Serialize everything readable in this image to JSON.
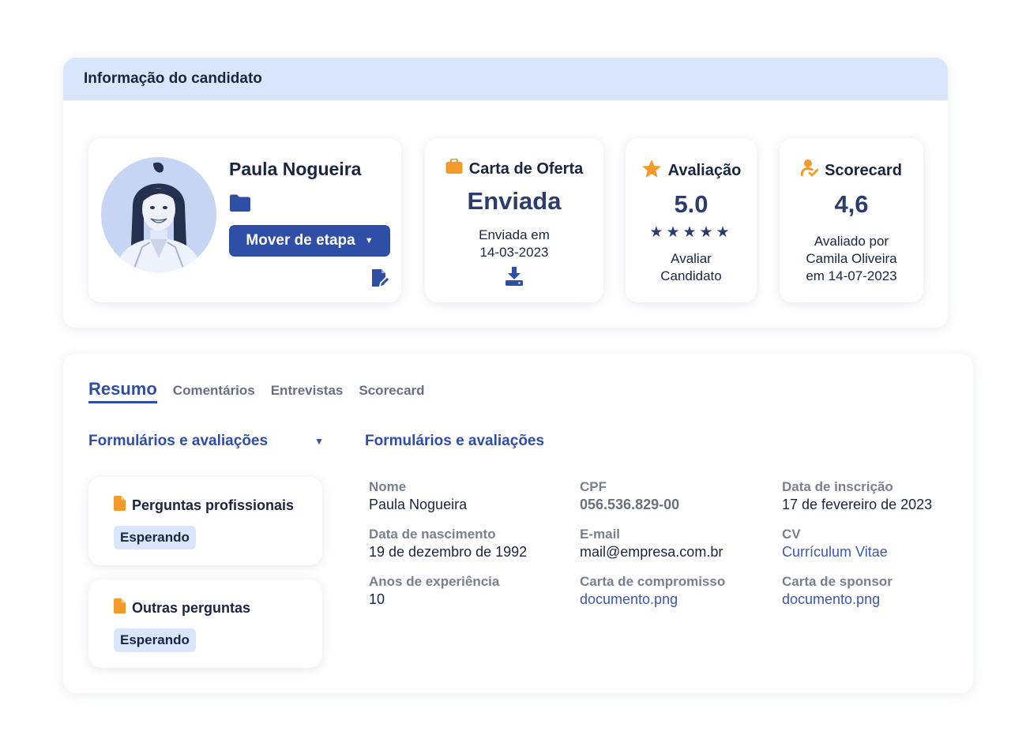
{
  "header": {
    "title": "Informação do candidato"
  },
  "candidate": {
    "name": "Paula Nogueira",
    "move_stage_label": "Mover de etapa"
  },
  "offer": {
    "title": "Carta de Oferta",
    "status": "Enviada",
    "sent_label": "Enviada em",
    "sent_date": "14-03-2023"
  },
  "rating": {
    "title": "Avaliação",
    "value": "5.0",
    "stars": "★★★★★",
    "stars_count": 5,
    "action_line1": "Avaliar",
    "action_line2": "Candidato"
  },
  "scorecard": {
    "title": "Scorecard",
    "value": "4,6",
    "line1": "Avaliado por",
    "line2": "Camila Oliveira",
    "line3": "em 14-07-2023"
  },
  "tabs": [
    {
      "label": "Resumo",
      "active": true
    },
    {
      "label": "Comentários"
    },
    {
      "label": "Entrevistas"
    },
    {
      "label": "Scorecard"
    }
  ],
  "forms": {
    "dropdown_label": "Formulários e avaliações",
    "items": [
      {
        "title": "Perguntas profissionais",
        "status": "Esperando"
      },
      {
        "title": "Outras perguntas",
        "status": "Esperando"
      }
    ]
  },
  "details": {
    "title": "Formulários e avaliações",
    "fields": [
      {
        "label": "Nome",
        "value": "Paula Nogueira"
      },
      {
        "label": "CPF",
        "value": "056.536.829-00"
      },
      {
        "label": "Data de inscrição",
        "value": "17 de fevereiro de 2023"
      },
      {
        "label": "Data de nascimento",
        "value": "19 de dezembro de 1992"
      },
      {
        "label": "E-mail",
        "value": "mail@empresa.com.br"
      },
      {
        "label": "CV",
        "value": "Currículum Vitae"
      },
      {
        "label": "Anos de experiência",
        "value": "10"
      },
      {
        "label": "Carta de compromisso",
        "value": "documento.png"
      },
      {
        "label": "Carta de sponsor",
        "value": "documento.png"
      }
    ]
  },
  "icons": {
    "offer": "briefcase-icon",
    "rating": "star-icon",
    "scorecard": "user-check-icon",
    "folder": "folder-icon",
    "edit": "edit-note-icon",
    "download": "download-icon",
    "document": "document-icon"
  },
  "colors": {
    "primary": "#2f4ea6",
    "header_bg": "#d9e5fb",
    "accent_orange": "#f39a2b",
    "text_dark": "#1b2440",
    "text_muted": "#7a7f8e"
  }
}
